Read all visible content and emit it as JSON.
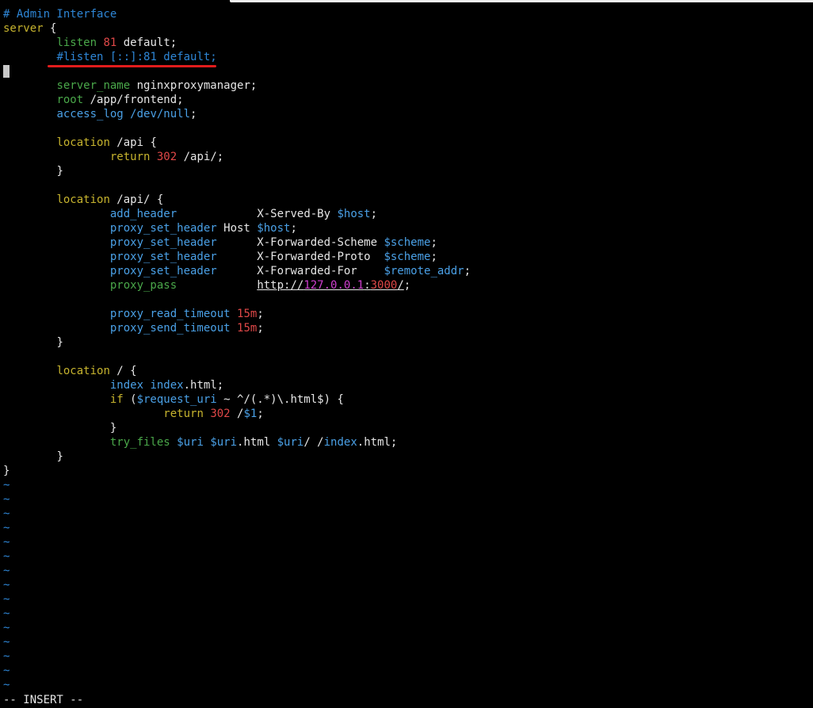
{
  "colors": {
    "background": "#000000",
    "comment": "#2e86d6",
    "keyword": "#c6b32e",
    "directive": "#4aa84a",
    "directive_alt": "#4aa0e6",
    "number": "#e04848",
    "variable": "#4aa0e6",
    "ip": "#d03fd0",
    "annotation": "#e21c1c"
  },
  "code": {
    "l1": "# Admin Interface",
    "l2_kw": "server",
    "l2_rest": " {",
    "l3_dir": "listen",
    "l3_num": "81",
    "l3_rest": " default;",
    "l4_comment": "#listen [::]:81 default;",
    "l6_dir": "server_name",
    "l6_rest": " nginxproxymanager;",
    "l7_dir": "root",
    "l7_rest": " /app/frontend;",
    "l8_dir": "access_log",
    "l8_rest": " /dev/null",
    "l8_end": ";",
    "l10_kw": "location",
    "l10_rest": " /api {",
    "l11_kw": "return",
    "l11_num": "302",
    "l11_rest": " /api/;",
    "l12": "}",
    "l14_kw": "location",
    "l14_rest": " /api/ {",
    "l15_dir": "add_header",
    "l15_mid": "X-Served-By ",
    "l15_var": "$host",
    "l15_end": ";",
    "l16_dir": "proxy_set_header",
    "l16_mid": " Host ",
    "l16_var": "$host",
    "l16_end": ";",
    "l17_dir": "proxy_set_header",
    "l17_mid": "X-Forwarded-Scheme ",
    "l17_var": "$scheme",
    "l17_end": ";",
    "l18_dir": "proxy_set_header",
    "l18_mid": "X-Forwarded-Proto  ",
    "l18_var": "$scheme",
    "l18_end": ";",
    "l19_dir": "proxy_set_header",
    "l19_mid": "X-Forwarded-For    ",
    "l19_var": "$remote_addr",
    "l19_end": ";",
    "l20_dir": "proxy_pass",
    "l20_p1": "http://",
    "l20_ip": "127.0.0.1",
    "l20_colon": ":",
    "l20_port": "3000",
    "l20_slash": "/",
    "l20_end": ";",
    "l22_dir": "proxy_read_timeout",
    "l22_num": "15m",
    "l22_end": ";",
    "l23_dir": "proxy_send_timeout",
    "l23_num": "15m",
    "l23_end": ";",
    "l24": "}",
    "l26_kw": "location",
    "l26_rest": " / {",
    "l27_dir": "index",
    "l27_file": "index",
    "l27_rest": ".html;",
    "l28_kw": "if",
    "l28_p1": " (",
    "l28_var": "$request_uri",
    "l28_rest": " ~ ^/(.*)\\.html$) {",
    "l29_kw": "return",
    "l29_num": "302",
    "l29_mid": " /",
    "l29_var": "$1",
    "l29_end": ";",
    "l30": "}",
    "l31_dir": "try_files",
    "l31_v1": "$uri",
    "l31_v2": "$uri",
    "l31_m2": ".html ",
    "l31_v3": "$uri",
    "l31_m3": "/ /",
    "l31_file": "index",
    "l31_end": ".html;",
    "l32": "}",
    "l33": "}"
  },
  "tilde": "~",
  "status": {
    "mode": "-- INSERT --"
  }
}
